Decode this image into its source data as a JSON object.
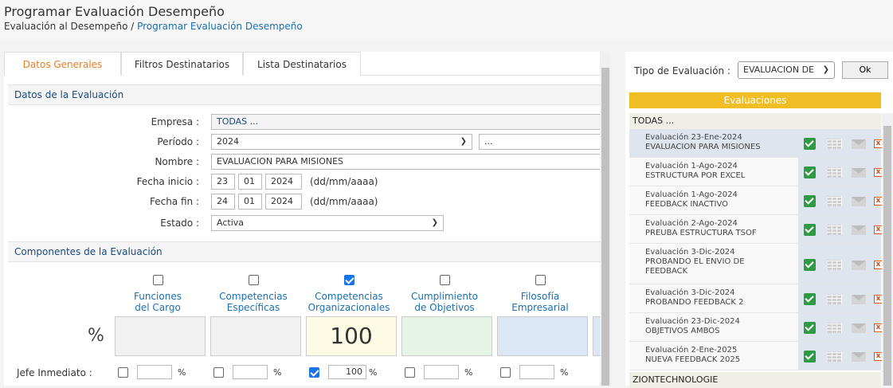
{
  "header": {
    "title": "Programar Evaluación Desempeño",
    "breadcrumb_root": "Evaluación al Desempeño",
    "breadcrumb_sep": " / ",
    "breadcrumb_current": "Programar Evaluación Desempeño"
  },
  "tabs": [
    {
      "label": "Datos Generales",
      "active": true
    },
    {
      "label": "Filtros Destinatarios",
      "active": false
    },
    {
      "label": "Lista Destinatarios",
      "active": false
    }
  ],
  "datos": {
    "section_title": "Datos de la Evaluación",
    "empresa_label": "Empresa :",
    "empresa_value": "TODAS ...",
    "periodo_label": "Período :",
    "periodo_value": "2024",
    "periodo_extra": "...",
    "nombre_label": "Nombre :",
    "nombre_value": "EVALUACION PARA MISIONES",
    "fecha_inicio_label": "Fecha inicio :",
    "fecha_inicio": {
      "dd": "23",
      "mm": "01",
      "aaaa": "2024"
    },
    "fecha_fin_label": "Fecha fin :",
    "fecha_fin": {
      "dd": "24",
      "mm": "01",
      "aaaa": "2024"
    },
    "date_hint": "(dd/mm/aaaa)",
    "estado_label": "Estado :",
    "estado_value": "Activa"
  },
  "componentes": {
    "section_title": "Componentes de la Evaluación",
    "percent_symbol": "%",
    "items": [
      {
        "line1": "Funciones",
        "line2": "del Cargo",
        "checked": false,
        "value": "",
        "color": "#f1f1f1",
        "jefe_checked": false,
        "jefe_value": ""
      },
      {
        "line1": "Competencias",
        "line2": "Específicas",
        "checked": false,
        "value": "",
        "color": "#f1f1f1",
        "jefe_checked": false,
        "jefe_value": ""
      },
      {
        "line1": "Competencias",
        "line2": "Organizacionales",
        "checked": true,
        "value": "100",
        "color": "#fdfbe3",
        "jefe_checked": true,
        "jefe_value": "100"
      },
      {
        "line1": "Cumplimiento",
        "line2": "de Objetivos",
        "checked": false,
        "value": "",
        "color": "#e6f4e6",
        "jefe_checked": false,
        "jefe_value": ""
      },
      {
        "line1": "Filosofía",
        "line2": "Empresarial",
        "checked": false,
        "value": "",
        "color": "#dbe7f4",
        "jefe_checked": false,
        "jefe_value": ""
      }
    ],
    "jefe_label": "Jefe Inmediato :",
    "pct": "%"
  },
  "right": {
    "tipo_label": "Tipo de Evaluación :",
    "tipo_value": "EVALUACION DE",
    "ok_label": "Ok",
    "evaluaciones_title": "Evaluaciones",
    "group1": "TODAS ...",
    "group2": "ZIONTECHNOLOGIE",
    "evals": [
      {
        "line1": "Evaluación 23-Ene-2024",
        "line2": "EVALUACION PARA MISIONES",
        "line3": ""
      },
      {
        "line1": "Evaluación 1-Ago-2024",
        "line2": "ESTRUCTURA POR EXCEL",
        "line3": ""
      },
      {
        "line1": "Evaluación 1-Ago-2024",
        "line2": "FEEDBACK INACTIVO",
        "line3": ""
      },
      {
        "line1": "Evaluación 2-Ago-2024",
        "line2": "PREUBA ESTRUCTURA TSOF",
        "line3": ""
      },
      {
        "line1": "Evaluación 3-Dic-2024",
        "line2": "PROBANDO EL ENVIO DE",
        "line3": "FEEDBACK"
      },
      {
        "line1": "Evaluación 3-Dic-2024",
        "line2": "PROBANDO FEEDBACK 2",
        "line3": ""
      },
      {
        "line1": "Evaluación 23-Dic-2024",
        "line2": "OBJETIVOS AMBOS",
        "line3": ""
      },
      {
        "line1": "Evaluación 2-Ene-2025",
        "line2": "NUEVA FEEDBACK 2025",
        "line3": ""
      }
    ],
    "x_glyph": "x"
  }
}
